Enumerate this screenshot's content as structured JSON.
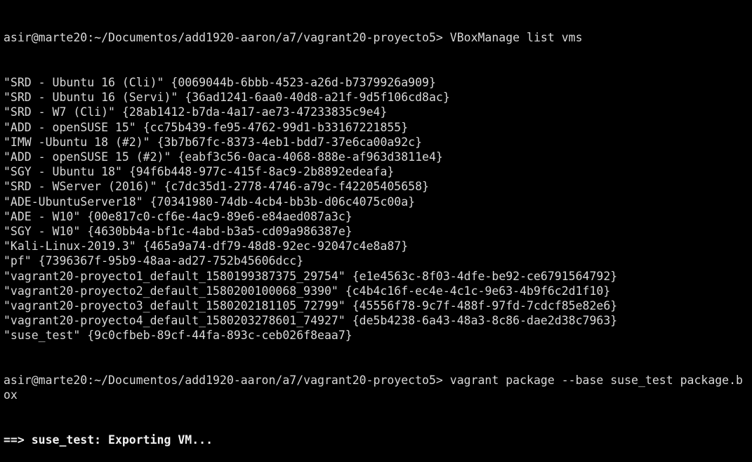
{
  "terminal": {
    "prompt": "asir@marte20:~/Documentos/add1920-aaron/a7/vagrant20-proyecto5> ",
    "command1": "VBoxManage list vms",
    "vms": [
      {
        "name": "\"SRD - Ubuntu 16 (Cli)\"",
        "uuid": "{0069044b-6bbb-4523-a26d-b7379926a909}"
      },
      {
        "name": "\"SRD - Ubuntu 16 (Servi)\"",
        "uuid": "{36ad1241-6aa0-40d8-a21f-9d5f106cd8ac}"
      },
      {
        "name": "\"SRD - W7 (Cli)\"",
        "uuid": "{28ab1412-b7da-4a17-ae73-47233835c9e4}"
      },
      {
        "name": "\"ADD - openSUSE 15\"",
        "uuid": "{cc75b439-fe95-4762-99d1-b33167221855}"
      },
      {
        "name": "\"IMW -Ubuntu 18 (#2)\"",
        "uuid": "{3b7b67fc-8373-4eb1-bdd7-37e6ca00a92c}"
      },
      {
        "name": "\"ADD - openSUSE 15 (#2)\"",
        "uuid": "{eabf3c56-0aca-4068-888e-af963d3811e4}"
      },
      {
        "name": "\"SGY - Ubuntu 18\"",
        "uuid": "{94f6b448-977c-415f-8ac9-2b8892edeafa}"
      },
      {
        "name": "\"SRD - WServer (2016)\"",
        "uuid": "{c7dc35d1-2778-4746-a79c-f42205405658}"
      },
      {
        "name": "\"ADE-UbuntuServer18\"",
        "uuid": "{70341980-74db-4cb4-bb3b-d06c4075c00a}"
      },
      {
        "name": "\"ADE - W10\"",
        "uuid": "{00e817c0-cf6e-4ac9-89e6-e84aed087a3c}"
      },
      {
        "name": "\"SGY - W10\"",
        "uuid": "{4630bb4a-bf1c-4abd-b3a5-cd09a986387e}"
      },
      {
        "name": "\"Kali-Linux-2019.3\"",
        "uuid": "{465a9a74-df79-48d8-92ec-92047c4e8a87}"
      },
      {
        "name": "\"pf\"",
        "uuid": "{7396367f-95b9-48aa-ad27-752b45606dcc}"
      },
      {
        "name": "\"vagrant20-proyecto1_default_1580199387375_29754\"",
        "uuid": "{e1e4563c-8f03-4dfe-be92-ce6791564792}"
      },
      {
        "name": "\"vagrant20-proyecto2_default_1580200100068_9390\"",
        "uuid": "{c4b4c16f-ec4e-4c1c-9e63-4b9f6c2d1f10}"
      },
      {
        "name": "\"vagrant20-proyecto3_default_1580202181105_72799\"",
        "uuid": "{45556f78-9c7f-488f-97fd-7cdcf85e82e6}"
      },
      {
        "name": "\"vagrant20-proyecto4_default_1580203278601_74927\"",
        "uuid": "{de5b4238-6a43-48a3-8c86-dae2d38c7963}"
      },
      {
        "name": "\"suse_test\"",
        "uuid": "{9c0cfbeb-89cf-44fa-893c-ceb026f8eaa7}"
      }
    ],
    "command2": "vagrant package --base suse_test package.box",
    "output": "==> suse_test: Exporting VM..."
  },
  "colors": {
    "background": "#000000",
    "text": "#d8d8d8"
  }
}
